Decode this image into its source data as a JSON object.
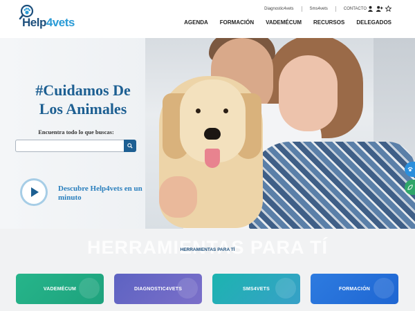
{
  "logo": {
    "text_main": "Help",
    "text_accent": "4vets"
  },
  "top_links": [
    "Diagnostic4vets",
    "Sms4vets",
    "CONTACTO"
  ],
  "icons": [
    "user-icon",
    "add-user-icon",
    "star-icon",
    "search-icon",
    "play-icon"
  ],
  "nav": [
    "AGENDA",
    "FORMACIÓN",
    "VADEMÉCUM",
    "RECURSOS",
    "DELEGADOS"
  ],
  "hero": {
    "title": "#Cuidamos De Los Animales",
    "search_label": "Encuentra todo lo que buscas:",
    "search_placeholder": "",
    "discover": "Descubre Help4vets en un minuto"
  },
  "tools": {
    "big_title": "HERRAMIENTAS PARA TÍ",
    "small_title": "HERRAMIENTAS PARA TÍ",
    "cards": [
      "VADEMÉCUM",
      "DIAGNOSTIC4VETS",
      "SMS4VETS",
      "FORMACIÓN"
    ]
  },
  "colors": {
    "primary": "#1d5f92",
    "accent": "#2a9bd6",
    "side_blue": "#2b8fdc",
    "side_green": "#2fa66a"
  }
}
